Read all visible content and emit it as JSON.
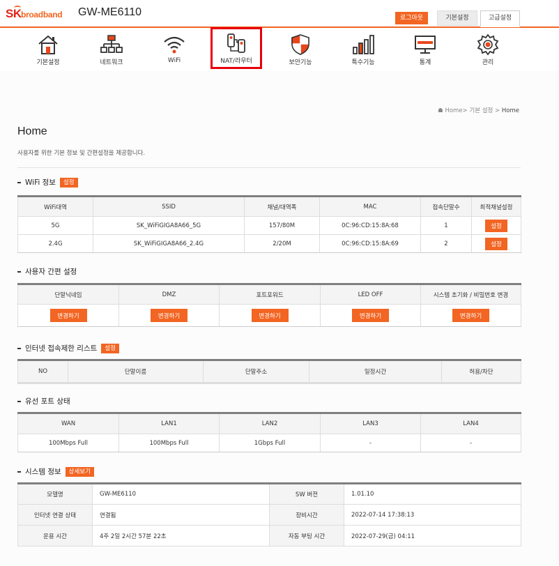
{
  "header": {
    "logo_sk": "SK",
    "logo_broadband": "broadband",
    "model": "GW-ME6110",
    "logout": "로그아웃",
    "tab_basic": "기본설정",
    "tab_advanced": "고급설정"
  },
  "nav": [
    {
      "label": "기본설정",
      "icon": "house-icon"
    },
    {
      "label": "네트워크",
      "icon": "network-icon"
    },
    {
      "label": "WiFi",
      "icon": "wifi-icon"
    },
    {
      "label": "NAT/라우터",
      "icon": "router-icon",
      "active": true
    },
    {
      "label": "보안기능",
      "icon": "shield-icon"
    },
    {
      "label": "특수기능",
      "icon": "bars-icon"
    },
    {
      "label": "통계",
      "icon": "monitor-icon"
    },
    {
      "label": "관리",
      "icon": "gear-icon"
    }
  ],
  "breadcrumb": {
    "home": "Home",
    "mid": "기본 설정",
    "current": "Home"
  },
  "page": {
    "title": "Home",
    "description": "사용자를 위한 기본 정보 및 간편설정을 제공합니다."
  },
  "wifi": {
    "heading": "WiFi 정보",
    "set_label": "설정",
    "headers": [
      "WiFi대역",
      "SSID",
      "채널/대역폭",
      "MAC",
      "접속단말수",
      "최적채널설정"
    ],
    "rows": [
      {
        "band": "5G",
        "ssid": "SK_WiFiGIGA8A66_5G",
        "channel": "157/80M",
        "mac": "0C:96:CD:15:8A:68",
        "count": "1",
        "btn": "설정"
      },
      {
        "band": "2.4G",
        "ssid": "SK_WiFiGIGA8A66_2.4G",
        "channel": "2/20M",
        "mac": "0C:96:CD:15:8A:69",
        "count": "2",
        "btn": "설정"
      }
    ]
  },
  "quick": {
    "heading": "사용자 간편 설정",
    "headers": [
      "단말닉네임",
      "DMZ",
      "포트포워드",
      "LED OFF",
      "시스템 초기화 / 비밀번호 변경"
    ],
    "button": "변경하기"
  },
  "restrict": {
    "heading": "인터넷 접속제한 리스트",
    "set_label": "설정",
    "headers": [
      "NO",
      "단말이름",
      "단말주소",
      "일정시간",
      "허용/차단"
    ]
  },
  "ports": {
    "heading": "유선 포트 상태",
    "headers": [
      "WAN",
      "LAN1",
      "LAN2",
      "LAN3",
      "LAN4"
    ],
    "values": [
      "100Mbps Full",
      "100Mbps Full",
      "1Gbps Full",
      "-",
      "-"
    ]
  },
  "system": {
    "heading": "시스템 정보",
    "detail_label": "상세보기",
    "rows": [
      {
        "k1": "모델명",
        "v1": "GW-ME6110",
        "k2": "SW 버전",
        "v2": "1.01.10"
      },
      {
        "k1": "인터넷 연결 상태",
        "v1": "연결됨",
        "k2": "장비시간",
        "v2": "2022-07-14 17:38:13"
      },
      {
        "k1": "운용 시간",
        "v1": "4주 2일 2시간 57분 22초",
        "k2": "자동 부팅 시간",
        "v2": "2022-07-29(금) 04:11"
      }
    ]
  },
  "colors": {
    "accent": "#f26522",
    "active_border": "#e8000a"
  }
}
